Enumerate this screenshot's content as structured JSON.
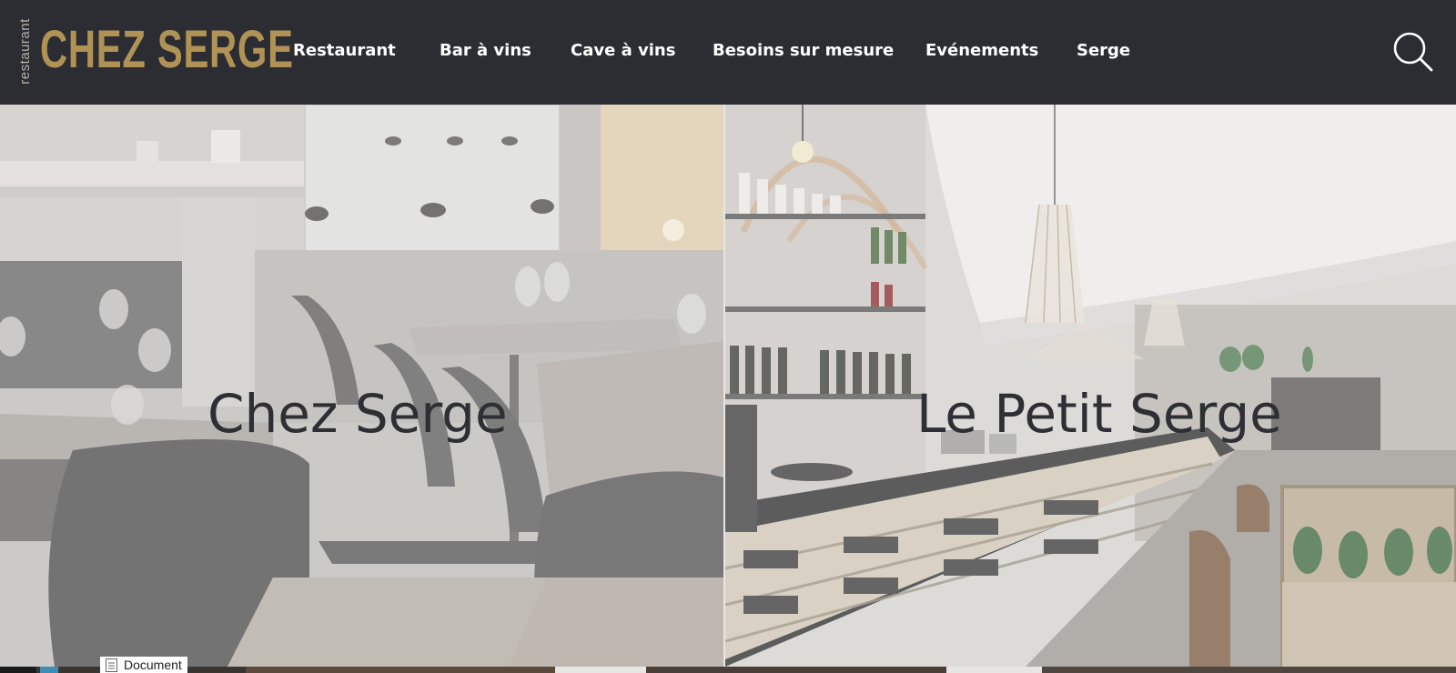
{
  "brand": {
    "small": "restaurant",
    "name": "CHEZ SERGE",
    "color": "#b09255"
  },
  "nav": {
    "items": [
      {
        "label": "Restaurant"
      },
      {
        "label": "Bar à vins"
      },
      {
        "label": "Cave à vins"
      },
      {
        "label": "Besoins sur mesure"
      },
      {
        "label": "Evénements"
      },
      {
        "label": "Serge"
      }
    ]
  },
  "search": {
    "icon": "search-icon"
  },
  "panels": [
    {
      "title": "Chez Serge"
    },
    {
      "title": "Le Petit Serge"
    }
  ],
  "taskbar": {
    "document_label": "Document"
  },
  "colors": {
    "header_bg": "#2b2d33",
    "nav_text": "#ffffff",
    "panel_title": "#2e2f35"
  }
}
